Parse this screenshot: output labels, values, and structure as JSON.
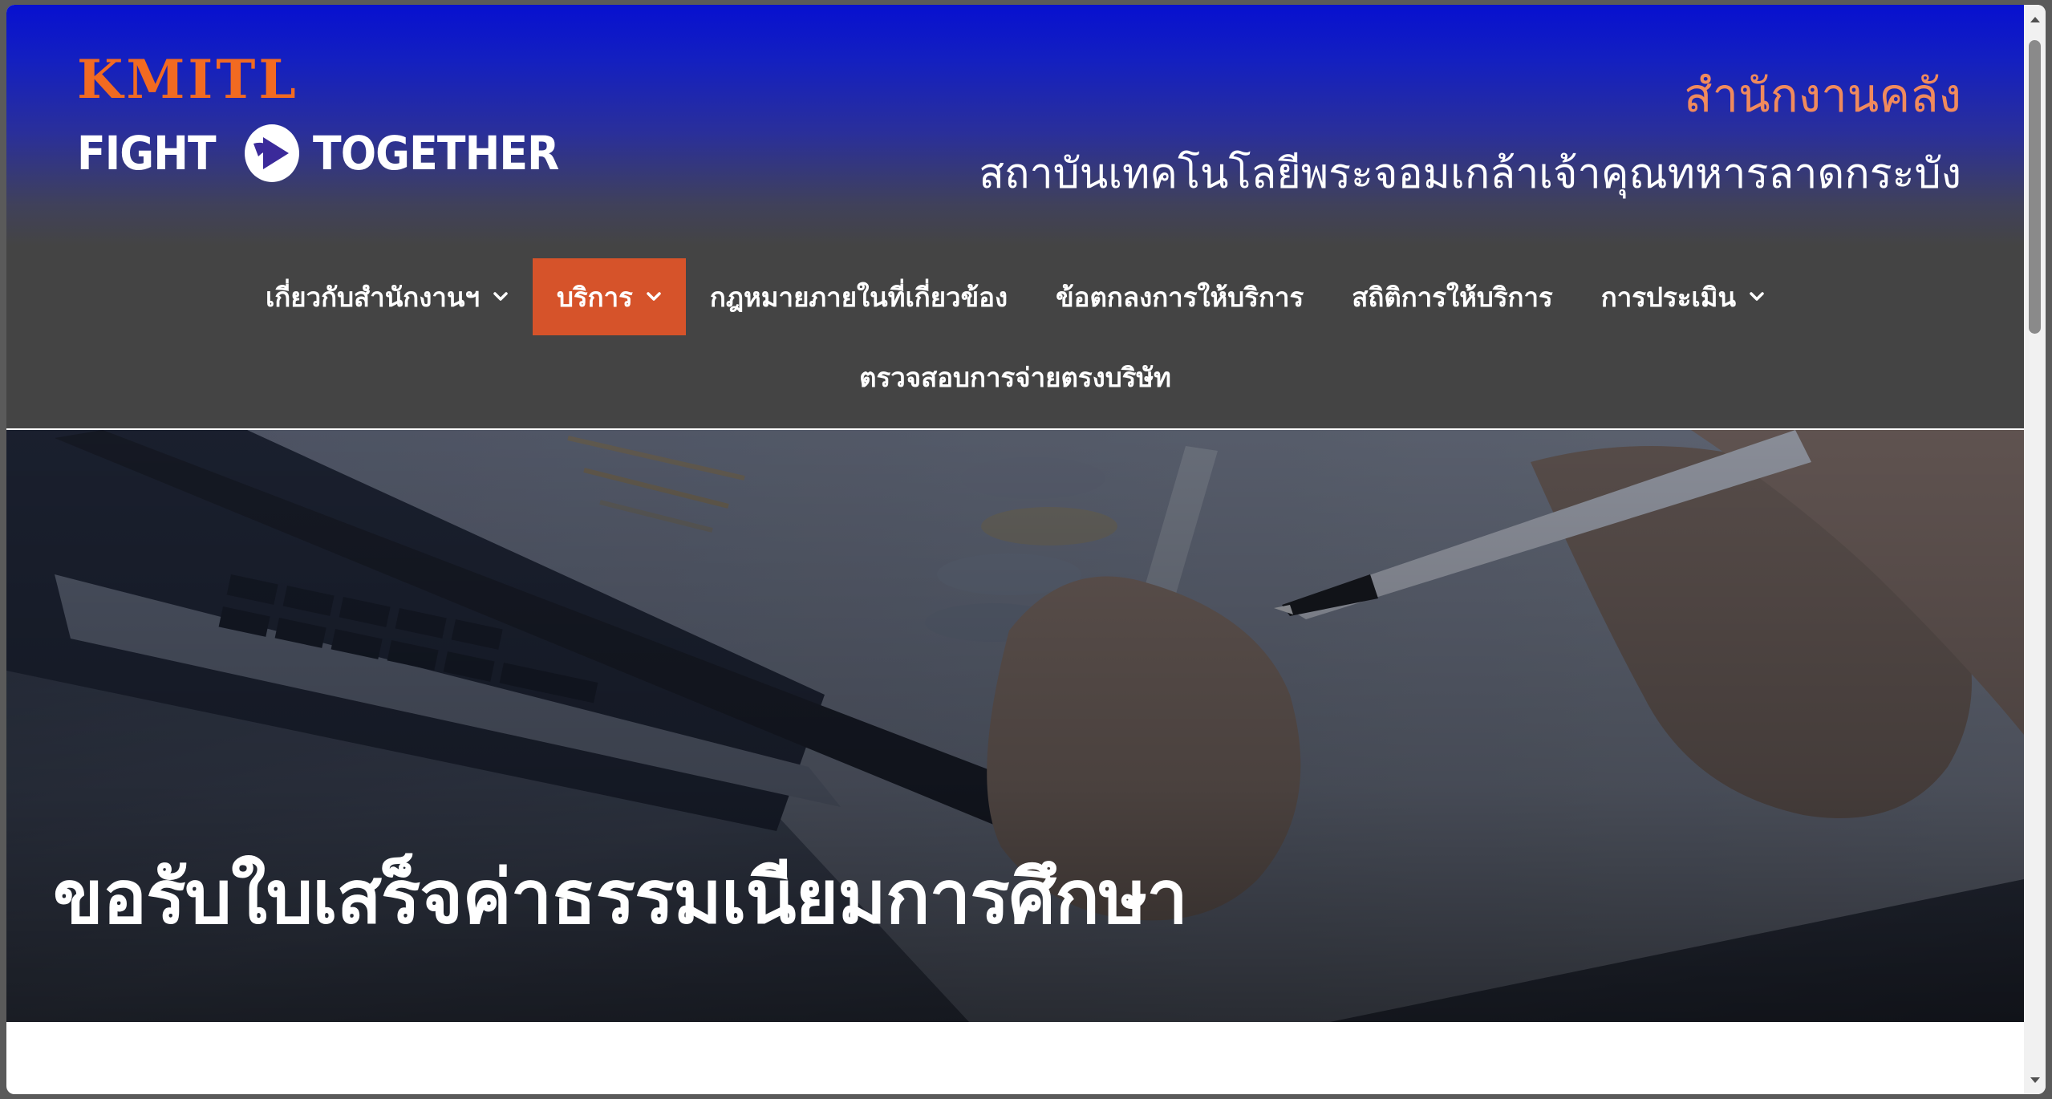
{
  "header": {
    "logo_line1": "KMITL",
    "logo_word_left": "FIGHT",
    "logo_word_right": "TOGETHER",
    "office_title": "สำนักงานคลัง",
    "institute_name": "สถาบันเทคโนโลยีพระจอมเกล้าเจ้าคุณทหารลาดกระบัง"
  },
  "nav": {
    "items": [
      {
        "label": "เกี่ยวกับสำนักงานฯ",
        "has_dropdown": true,
        "active": false
      },
      {
        "label": "บริการ",
        "has_dropdown": true,
        "active": true
      },
      {
        "label": "กฎหมายภายในที่เกี่ยวข้อง",
        "has_dropdown": false,
        "active": false
      },
      {
        "label": "ข้อตกลงการให้บริการ",
        "has_dropdown": false,
        "active": false
      },
      {
        "label": "สถิติการให้บริการ",
        "has_dropdown": false,
        "active": false
      },
      {
        "label": "การประเมิน",
        "has_dropdown": true,
        "active": false
      },
      {
        "label": "ตรวจสอบการจ่ายตรงบริษัท",
        "has_dropdown": false,
        "active": false
      }
    ]
  },
  "hero": {
    "title": "ขอรับใบเสร็จค่าธรรมเนียมการศึกษา"
  },
  "colors": {
    "header_blue": "#0710d0",
    "nav_bg": "#444444",
    "active_nav": "#d6532a",
    "office_title": "#f08a5d",
    "logo_orange": "#f26a21"
  },
  "icons": {
    "dropdown": "chevron-down-icon",
    "logo_emblem": "play-emblem-icon",
    "scroll_up": "scroll-up-arrow-icon",
    "scroll_down": "scroll-down-arrow-icon"
  }
}
